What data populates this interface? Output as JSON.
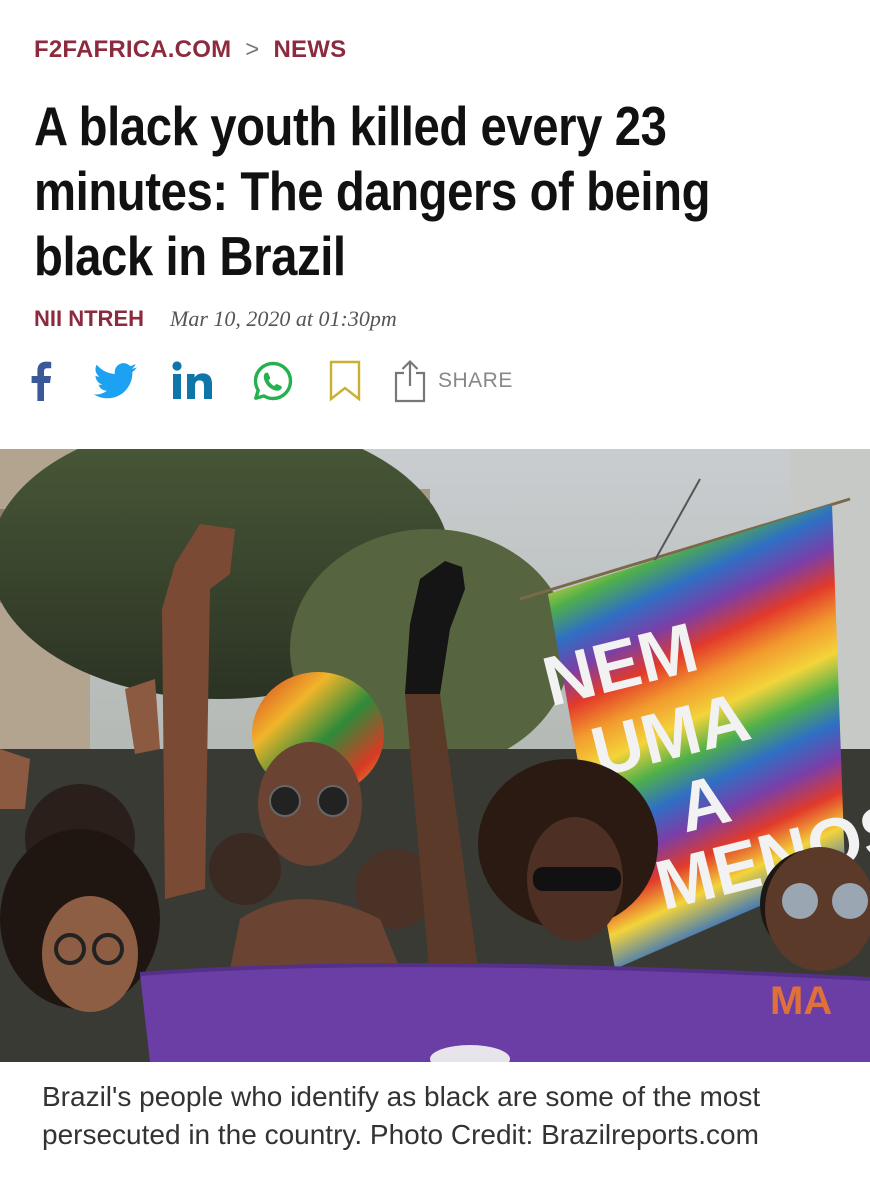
{
  "breadcrumb": {
    "site": "F2FAFRICA.COM",
    "separator": ">",
    "section": "NEWS"
  },
  "article": {
    "title": "A black youth killed every 23 minutes: The dangers of being black in Brazil",
    "author": "NII NTREH",
    "date": "Mar 10, 2020 at 01:30pm"
  },
  "share_bar": {
    "icons": [
      "facebook-icon",
      "twitter-icon",
      "linkedin-icon",
      "whatsapp-icon",
      "bookmark-icon",
      "share-icon"
    ],
    "share_label": "SHARE",
    "colors": {
      "facebook": "#3b5998",
      "twitter": "#1da1f2",
      "linkedin": "#0e76a8",
      "whatsapp": "#25b14f",
      "bookmark": "#c9b030",
      "share": "#777777"
    }
  },
  "photo": {
    "banner_text": [
      "NEM",
      "UMA",
      "A",
      "MENOS"
    ],
    "front_banner_text": "MA"
  },
  "caption": "Brazil's people who identify as black are some of the most persecuted in the country. Photo Credit: Brazilreports.com",
  "colors": {
    "accent": "#8c2a3e",
    "headline": "#111111",
    "caption": "#333333"
  }
}
